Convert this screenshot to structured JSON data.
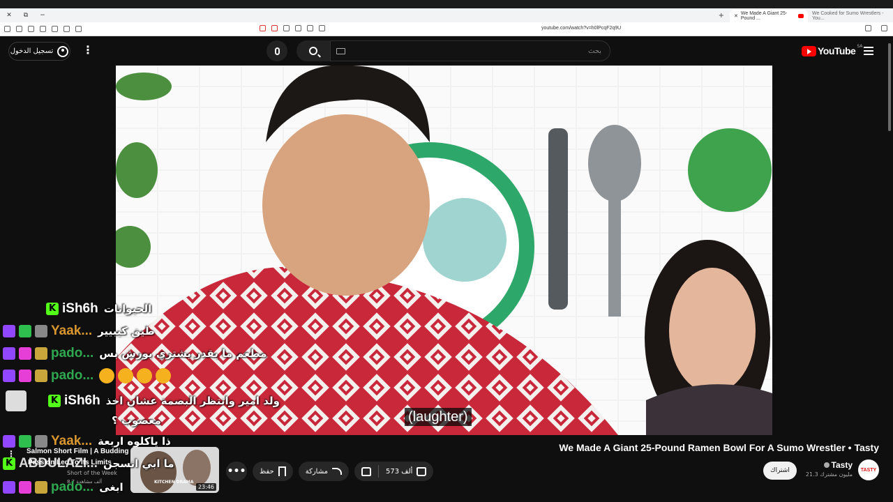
{
  "browser": {
    "tabs": [
      {
        "label": "We Made A Giant 25-Pound ...",
        "active": true
      },
      {
        "label": "We Cooked for Sumo Wrestlers - You...",
        "active": false
      }
    ],
    "url": "youtube.com/watch?v=h0lPcqF2q9U"
  },
  "header": {
    "signin_label": "تسجيل الدخول",
    "search_placeholder": "بحث",
    "logo_text": "YouTube",
    "country_code": "SA"
  },
  "video": {
    "subtitle": "(laughter)",
    "title": "We Made A Giant 25-Pound Ramen Bowl For A Sumo Wrestler • Tasty",
    "like_count": "573 ألف",
    "share_label": "مشاركة",
    "save_label": "حفظ",
    "more_label": "•••"
  },
  "channel": {
    "name": "Tasty",
    "subscribers": "21.3 مليون مشترك",
    "subscribe_label": "اشتراك",
    "avatar_text": "TASTY"
  },
  "chat": {
    "messages": [
      {
        "badges": [
          "kick"
        ],
        "user": "iSh6h",
        "user_color": "#ffffff",
        "text": "الحيوانات"
      },
      {
        "badges": [
          "twitch",
          "green",
          "gray"
        ],
        "user": "Yaak...",
        "user_color": "#d9962e",
        "text": "طيق كيبيير"
      },
      {
        "badges": [
          "twitch",
          "pink",
          "gold"
        ],
        "user": "pado...",
        "user_color": "#2fa84f",
        "text": "مطعم ما يقدر يشتري بورش بس"
      },
      {
        "badges": [
          "twitch",
          "pink",
          "gold"
        ],
        "user": "pado...",
        "user_color": "#2fa84f",
        "text": ""
      },
      {
        "badges": [
          "tasty",
          "kick"
        ],
        "user": "iSh6h",
        "user_color": "#ffffff",
        "text": "ولد امير وانتظر البصمة عشان اخذ"
      },
      {
        "badges": [],
        "user": "",
        "user_color": "#ffffff",
        "text": "معصوب ؟"
      },
      {
        "badges": [
          "twitch",
          "green",
          "gray"
        ],
        "user": "Yaak...",
        "user_color": "#d9962e",
        "text": "ذا ياكلوه اربعة"
      },
      {
        "badges": [
          "kick"
        ],
        "user": "ABDULAZI...",
        "user_color": "#ffffff",
        "text": "ما ابي انسجن"
      },
      {
        "badges": [
          "twitch",
          "pink",
          "gold"
        ],
        "user": "pado...",
        "user_color": "#2fa84f",
        "text": "ابغى"
      }
    ]
  },
  "recommendation": {
    "title": "Salmon Short Film | A Budding",
    "title2": "Passion Led To Its Limits ...",
    "channel": "Short of the Week",
    "views": "8.7 ألف مشاهدة",
    "duration": "23:46",
    "thumb_caption": "KITCHEN DRAMA"
  }
}
